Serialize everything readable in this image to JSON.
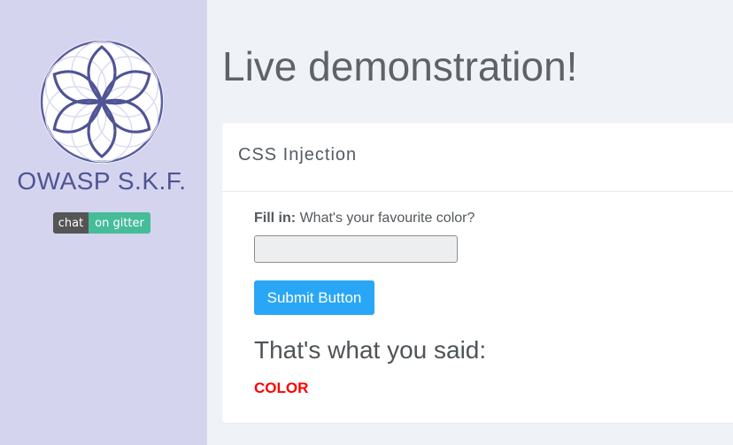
{
  "sidebar": {
    "brand": "OWASP S.K.F.",
    "badge": {
      "left": "chat",
      "right": "on gitter"
    },
    "logo_icon": "flower-of-life-logo-icon"
  },
  "main": {
    "title": "Live demonstration!",
    "card": {
      "title": "CSS Injection",
      "field_label_bold": "Fill in:",
      "field_label_text": "What's your favourite color?",
      "input_value": "",
      "input_placeholder": "",
      "submit_label": "Submit Button",
      "said_heading": "That's what you said:",
      "result_text": "COLOR",
      "result_color": "#ff0000"
    }
  },
  "colors": {
    "sidebar_bg": "#d4d4ee",
    "brand": "#4f5495",
    "button": "#2aa6f6",
    "badge_right": "#46bc99"
  }
}
